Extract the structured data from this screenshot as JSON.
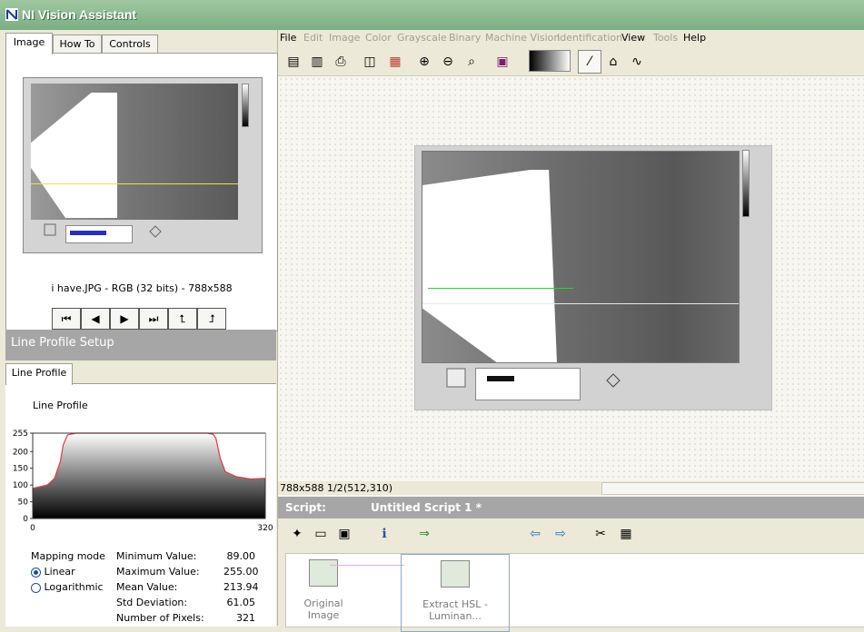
{
  "window": {
    "title": "NI Vision Assistant"
  },
  "tabs": [
    "Image",
    "How To",
    "Controls"
  ],
  "image_panel": {
    "file_info": "i have.JPG - RGB (32 bits) - 788x588"
  },
  "nav_icons": [
    "first-icon",
    "prev-icon",
    "next-icon",
    "last-icon",
    "up-icon",
    "redo-icon"
  ],
  "line_profile": {
    "header": "Line Profile Setup",
    "tab": "Line Profile",
    "chart_title": "Line Profile",
    "mapping_label": "Mapping mode",
    "modes": [
      "Linear",
      "Logarithmic"
    ],
    "selected_mode": "Linear",
    "stats": [
      {
        "label": "Minimum Value:",
        "value": "89.00"
      },
      {
        "label": "Maximum Value:",
        "value": "255.00"
      },
      {
        "label": "Mean Value:",
        "value": "213.94"
      },
      {
        "label": "Std Deviation:",
        "value": "61.05"
      },
      {
        "label": "Number of Pixels:",
        "value": "321"
      }
    ]
  },
  "chart_data": {
    "type": "line",
    "xlim": [
      0,
      320
    ],
    "ylim": [
      0,
      255
    ],
    "yticks": [
      0,
      50,
      100,
      150,
      200,
      255
    ],
    "xticks": [
      0,
      320
    ],
    "line_color": "#e53a3a",
    "x": [
      0,
      10,
      20,
      30,
      38,
      42,
      48,
      60,
      150,
      240,
      248,
      252,
      258,
      265,
      280,
      300,
      320
    ],
    "y": [
      90,
      95,
      100,
      120,
      170,
      220,
      250,
      255,
      255,
      255,
      252,
      240,
      180,
      140,
      125,
      118,
      120
    ]
  },
  "menu": [
    {
      "label": "File",
      "enabled": true
    },
    {
      "label": "Edit",
      "enabled": false
    },
    {
      "label": "Image",
      "enabled": false
    },
    {
      "label": "Color",
      "enabled": false
    },
    {
      "label": "Grayscale",
      "enabled": false
    },
    {
      "label": "Binary",
      "enabled": false
    },
    {
      "label": "Machine Vision",
      "enabled": false
    },
    {
      "label": "Identification",
      "enabled": false
    },
    {
      "label": "View",
      "enabled": true
    },
    {
      "label": "Tools",
      "enabled": false
    },
    {
      "label": "Help",
      "enabled": true
    }
  ],
  "status": {
    "size": "788x588 1/2",
    "coords": "(512,310)"
  },
  "script": {
    "label": "Script:",
    "title": "Untitled Script 1 *"
  },
  "steps": [
    {
      "label": "Original Image"
    },
    {
      "label": "Extract HSL - Luminan..."
    }
  ]
}
